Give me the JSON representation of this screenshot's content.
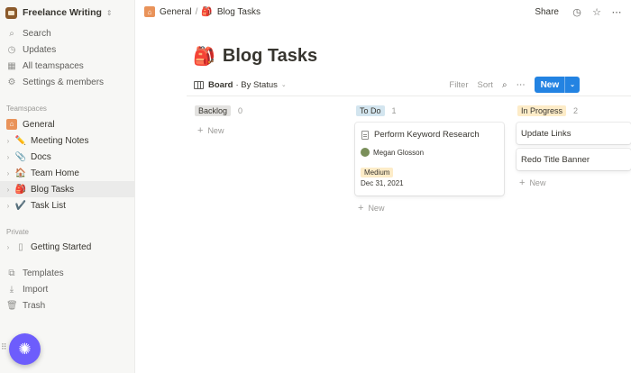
{
  "workspace": {
    "name": "Freelance Writing"
  },
  "sidebar": {
    "nav": [
      {
        "label": "Search",
        "icon": "search-icon"
      },
      {
        "label": "Updates",
        "icon": "clock-icon"
      },
      {
        "label": "All teamspaces",
        "icon": "grid-icon"
      },
      {
        "label": "Settings & members",
        "icon": "gear-icon"
      }
    ],
    "teamspaces_label": "Teamspaces",
    "teamspace": {
      "label": "General",
      "icon": "home-icon"
    },
    "pages": [
      {
        "label": "Meeting Notes",
        "emoji": "✏️"
      },
      {
        "label": "Docs",
        "emoji": "📎"
      },
      {
        "label": "Team Home",
        "emoji": "🏠"
      },
      {
        "label": "Blog Tasks",
        "emoji": "🎒"
      },
      {
        "label": "Task List",
        "emoji": "✔️"
      }
    ],
    "private_label": "Private",
    "private_pages": [
      {
        "label": "Getting Started",
        "icon": "page-icon"
      }
    ],
    "bottom": [
      {
        "label": "Templates",
        "icon": "templates-icon"
      },
      {
        "label": "Import",
        "icon": "import-icon"
      },
      {
        "label": "Trash",
        "icon": "trash-icon"
      }
    ]
  },
  "topbar": {
    "breadcrumb": [
      "General",
      "Blog Tasks"
    ],
    "share": "Share"
  },
  "page": {
    "title": "Blog Tasks",
    "emoji": "🎒"
  },
  "view": {
    "name": "Board",
    "group": "· By Status",
    "filter": "Filter",
    "sort": "Sort",
    "new_label": "New"
  },
  "board": {
    "add_label": "New",
    "columns": [
      {
        "name": "Backlog",
        "count": "0",
        "color": "#e3e2e0"
      },
      {
        "name": "To Do",
        "count": "1",
        "color": "#d3e5ef"
      },
      {
        "name": "In Progress",
        "count": "2",
        "color": "#fdecc8"
      }
    ],
    "todo_card": {
      "title": "Perform Keyword Research",
      "assignee": "Megan Glosson",
      "priority": "Medium",
      "date": "Dec 31, 2021"
    },
    "in_progress_cards": [
      "Update Links",
      "Redo Title Banner"
    ]
  },
  "colors": {
    "accent": "#2383e2",
    "fab": "#6d5dfc"
  }
}
